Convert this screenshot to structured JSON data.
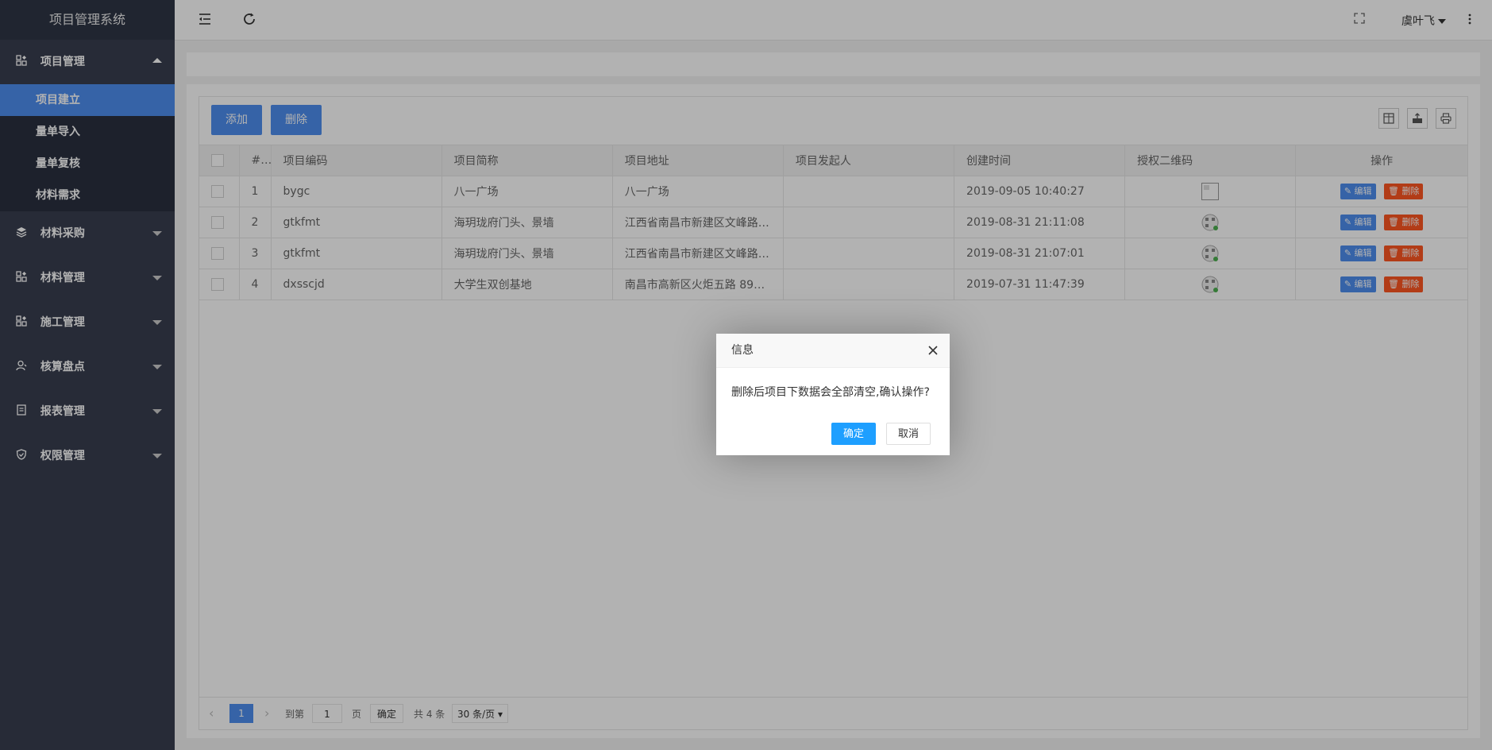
{
  "app": {
    "title": "项目管理系统"
  },
  "sidebar": {
    "groups": [
      {
        "label": "项目管理",
        "icon": "apps-icon",
        "expanded": true,
        "items": [
          {
            "label": "项目建立",
            "active": true
          },
          {
            "label": "量单导入",
            "active": false
          },
          {
            "label": "量单复核",
            "active": false
          },
          {
            "label": "材料需求",
            "active": false
          }
        ]
      },
      {
        "label": "材料采购",
        "icon": "layers-icon",
        "expanded": false
      },
      {
        "label": "材料管理",
        "icon": "apps-icon",
        "expanded": false
      },
      {
        "label": "施工管理",
        "icon": "apps-icon",
        "expanded": false
      },
      {
        "label": "核算盘点",
        "icon": "user-icon",
        "expanded": false
      },
      {
        "label": "报表管理",
        "icon": "report-icon",
        "expanded": false
      },
      {
        "label": "权限管理",
        "icon": "shield-icon",
        "expanded": false
      }
    ]
  },
  "topbar": {
    "username": "虞叶飞"
  },
  "toolbar": {
    "add_label": "添加",
    "delete_label": "删除"
  },
  "table": {
    "headers": [
      "#",
      "项目编码",
      "项目简称",
      "项目地址",
      "项目发起人",
      "创建时间",
      "授权二维码",
      "操作"
    ],
    "rows": [
      {
        "num": "1",
        "code": "bygc",
        "name": "八一广场",
        "address": "八一广场",
        "initiator": "",
        "created": "2019-09-05 10:40:27"
      },
      {
        "num": "2",
        "code": "gtkfmt",
        "name": "海玥珑府门头、景墙",
        "address": "江西省南昌市新建区文峰路…",
        "initiator": "",
        "created": "2019-08-31 21:11:08"
      },
      {
        "num": "3",
        "code": "gtkfmt",
        "name": "海玥珑府门头、景墙",
        "address": "江西省南昌市新建区文峰路…",
        "initiator": "",
        "created": "2019-08-31 21:07:01"
      },
      {
        "num": "4",
        "code": "dxsscjd",
        "name": "大学生双创基地",
        "address": "南昌市高新区火炬五路 899…",
        "initiator": "",
        "created": "2019-07-31 11:47:39"
      }
    ],
    "edit_label": "编辑",
    "delete_label": "删除"
  },
  "pager": {
    "current_page": "1",
    "goto_label": "到第",
    "page_input": "1",
    "page_suffix": "页",
    "confirm_label": "确定",
    "total_label": "共 4 条",
    "page_size": "30 条/页"
  },
  "dialog": {
    "title": "信息",
    "message": "删除后项目下数据会全部清空,确认操作?",
    "ok_label": "确定",
    "cancel_label": "取消"
  },
  "colors": {
    "sidebar_bg": "#383e4f",
    "accent": "#4e8eef",
    "danger": "#ff5722",
    "dialog_ok": "#1e9fff"
  }
}
